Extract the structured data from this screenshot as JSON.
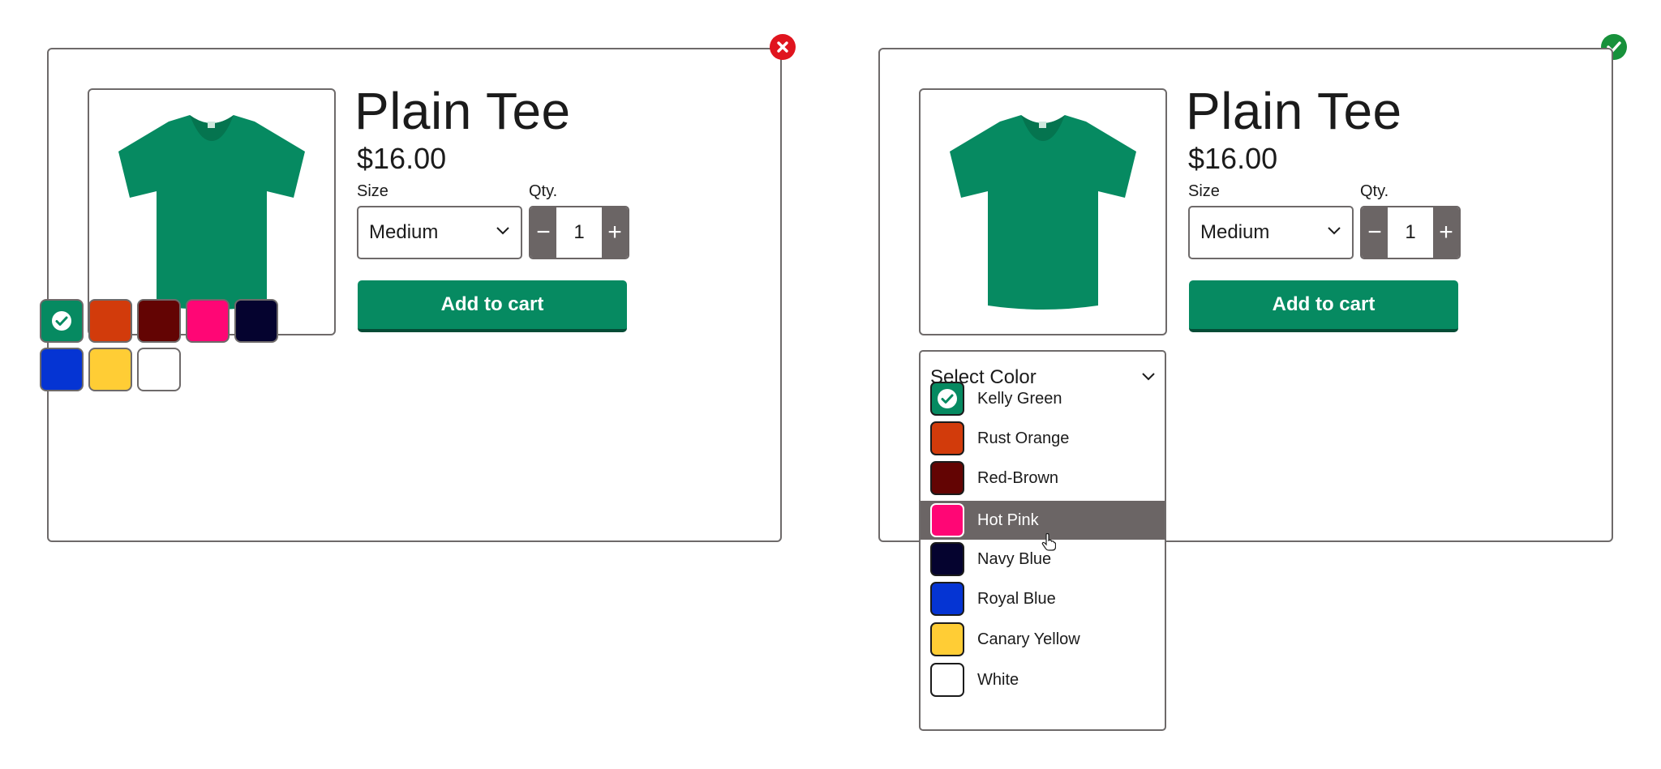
{
  "product": {
    "title": "Plain Tee",
    "price": "$16.00",
    "size_label": "Size",
    "size_value": "Medium",
    "qty_label": "Qty.",
    "qty_value": "1",
    "qty_minus": "−",
    "qty_plus": "+",
    "cart_label": "Add to cart",
    "shirt_color": "#068a61"
  },
  "status": {
    "bad_icon": "x-circle-icon",
    "good_icon": "check-circle-icon",
    "bad_color": "#e0141e",
    "good_color": "#17913b"
  },
  "swatches": [
    {
      "name": "Kelly Green",
      "color": "#068a61",
      "selected": true
    },
    {
      "name": "Rust Orange",
      "color": "#d23b0b",
      "selected": false
    },
    {
      "name": "Red-Brown",
      "color": "#630403",
      "selected": false
    },
    {
      "name": "Hot Pink",
      "color": "#ff0675",
      "selected": false
    },
    {
      "name": "Navy Blue",
      "color": "#05032f",
      "selected": false
    },
    {
      "name": "Royal Blue",
      "color": "#0534d3",
      "selected": false
    },
    {
      "name": "Canary Yellow",
      "color": "#ffcd35",
      "selected": false
    },
    {
      "name": "White",
      "color": "#ffffff",
      "selected": false
    }
  ],
  "dropdown": {
    "placeholder": "Select Color",
    "highlighted": "Hot Pink",
    "options": [
      "Kelly Green",
      "Rust Orange",
      "Red-Brown",
      "Hot Pink",
      "Navy Blue",
      "Royal Blue",
      "Canary Yellow",
      "White"
    ]
  }
}
